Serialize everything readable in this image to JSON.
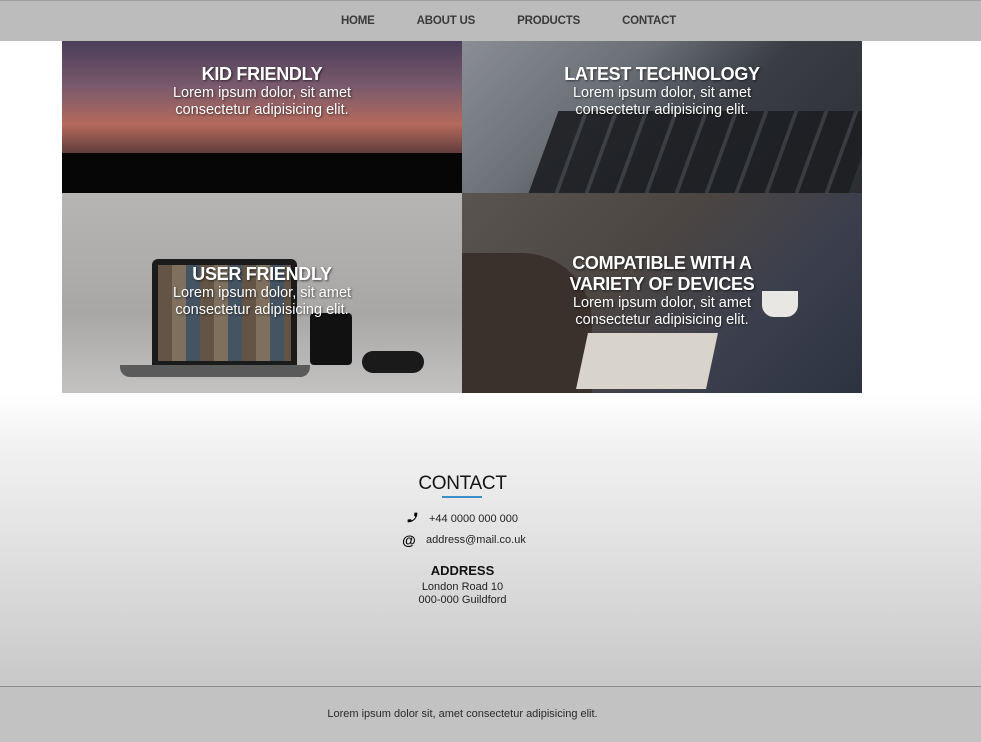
{
  "nav": {
    "items": [
      "HOME",
      "ABOUT US",
      "PRODUCTS",
      "CONTACT"
    ]
  },
  "tiles": [
    {
      "title": "KID FRIENDLY",
      "line1": "Lorem ipsum dolor, sit amet",
      "line2": "consectetur adipisicing elit."
    },
    {
      "title": "LATEST TECHNOLOGY",
      "line1": "Lorem ipsum dolor, sit amet",
      "line2": "consectetur adipisicing elit."
    },
    {
      "title": "USER FRIENDLY",
      "line1": "Lorem ipsum dolor, sit amet",
      "line2": "consectetur adipisicing elit."
    },
    {
      "title_line1": "COMPATIBLE WITH A",
      "title_line2": "VARIETY OF DEVICES",
      "line1": "Lorem ipsum dolor, sit amet",
      "line2": "consectetur adipisicing elit."
    }
  ],
  "contact": {
    "title": "CONTACT",
    "phone_icon": "phone-icon",
    "phone": "+44 0000 000 000",
    "email_icon": "at-icon",
    "email": "address@mail.co.uk",
    "address_title": "ADDRESS",
    "address_line1": "London Road 10",
    "address_line2": "000-000 Guildford"
  },
  "footer": {
    "text": "Lorem ipsum dolor sit, amet consectetur adipisicing elit."
  },
  "colors": {
    "navbar": "#bcbcbc",
    "accent_underline": "#3a8fc4",
    "footer": "#c2c2c2"
  }
}
